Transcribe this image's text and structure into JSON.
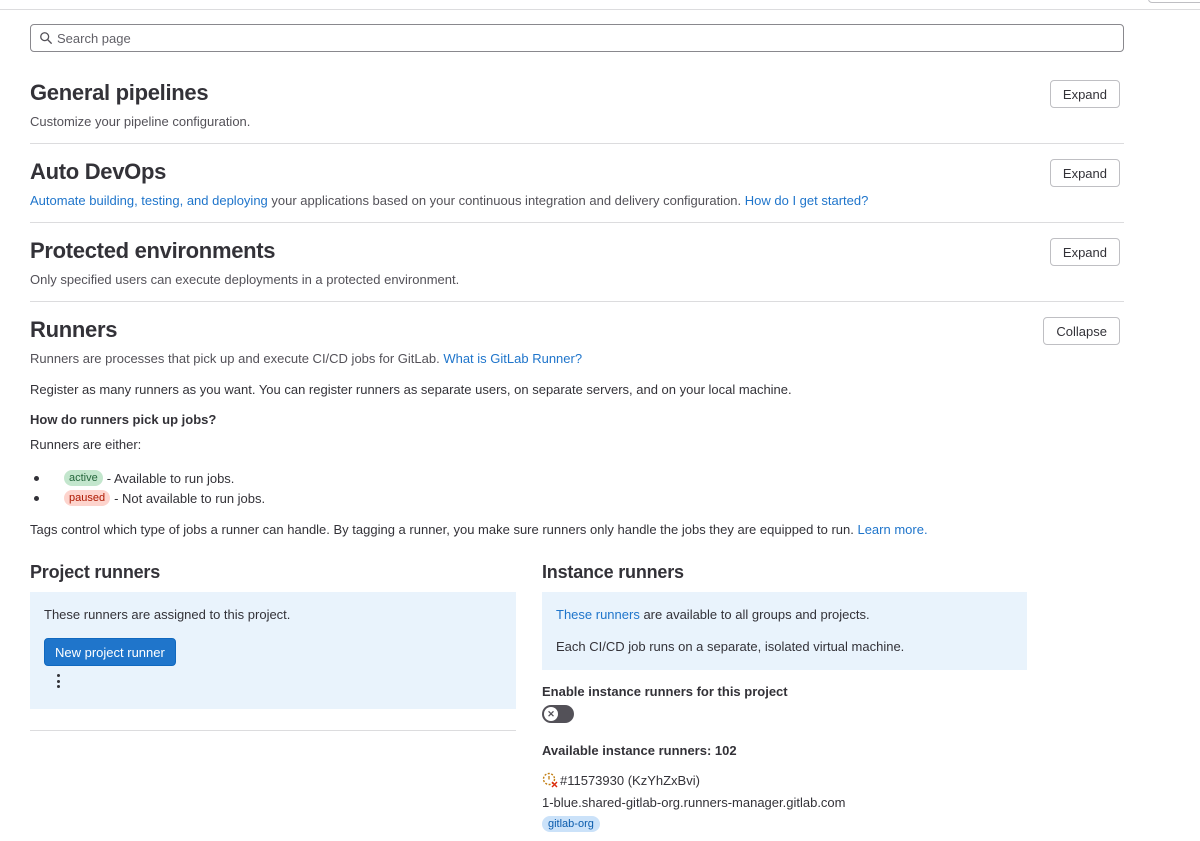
{
  "search": {
    "placeholder": "Search page"
  },
  "sections": {
    "general": {
      "title": "General pipelines",
      "description": "Customize your pipeline configuration.",
      "button": "Expand"
    },
    "autodevops": {
      "title": "Auto DevOps",
      "link1": "Automate building, testing, and deploying",
      "text": " your applications based on your continuous integration and delivery configuration. ",
      "link2": "How do I get started?",
      "button": "Expand"
    },
    "protected": {
      "title": "Protected environments",
      "description": "Only specified users can execute deployments in a protected environment.",
      "button": "Expand"
    },
    "runners": {
      "title": "Runners",
      "description": "Runners are processes that pick up and execute CI/CD jobs for GitLab. ",
      "link": "What is GitLab Runner?",
      "button": "Collapse"
    }
  },
  "runners_info": {
    "register": "Register as many runners as you want. You can register runners as separate users, on separate servers, and on your local machine.",
    "how_heading": "How do runners pick up jobs?",
    "either": "Runners are either:",
    "active_badge": "active",
    "active_text": "- Available to run jobs.",
    "paused_badge": "paused",
    "paused_text": "- Not available to run jobs.",
    "tags_text": "Tags control which type of jobs a runner can handle. By tagging a runner, you make sure runners only handle the jobs they are equipped to run. ",
    "tags_link": "Learn more."
  },
  "project_runners": {
    "title": "Project runners",
    "info": "These runners are assigned to this project.",
    "new_button": "New project runner"
  },
  "instance_runners": {
    "title": "Instance runners",
    "link": "These runners",
    "info_rest": " are available to all groups and projects.",
    "info2": "Each CI/CD job runs on a separate, isolated virtual machine.",
    "enable_label": "Enable instance runners for this project",
    "toggle_on": false,
    "available": "Available instance runners: 102",
    "runner_id": "#11573930 (KzYhZxBvi)",
    "runner_host": "1-blue.shared-gitlab-org.runners-manager.gitlab.com",
    "runner_tag": "gitlab-org"
  },
  "colors": {
    "link": "#1f75cb",
    "primary": "#1f75cb",
    "panel": "#e9f3fc"
  }
}
